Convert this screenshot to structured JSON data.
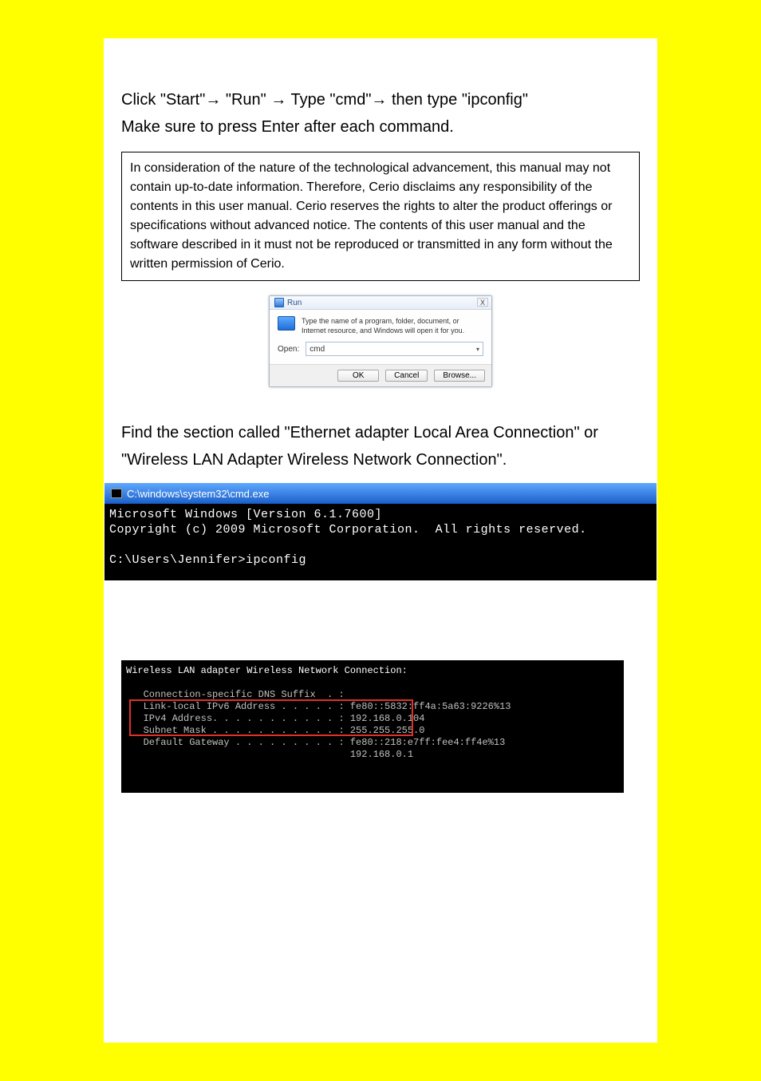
{
  "intro": {
    "p1": "Click \"Start\"→ \"Run\" → Type \"cmd\"→ then type \"ipconfig\"",
    "p2": "Make sure to press Enter after each command.",
    "legal": "In consideration of the nature of the technological advancement, this manual may not contain up-to-date information. Therefore, Cerio disclaims any responsibility of the contents in this user manual. Cerio reserves the rights to alter the product offerings or specifications without advanced notice. The contents of this user manual and the software described in it must not be reproduced or transmitted in any form without the written permission of Cerio."
  },
  "run_dialog": {
    "title": "Run",
    "close": "X",
    "description": "Type the name of a program, folder, document, or Internet resource, and Windows will open it for you.",
    "open_label": "Open:",
    "input_value": "cmd",
    "buttons": {
      "ok": "OK",
      "cancel": "Cancel",
      "browse": "Browse..."
    }
  },
  "instruction2": "Find the section called \"Ethernet adapter Local Area Connection\" or \"Wireless LAN Adapter Wireless Network Connection\".",
  "cmd_window": {
    "title_path": "C:\\windows\\system32\\cmd.exe",
    "line1": "Microsoft Windows [Version 6.1.7600]",
    "line2": "Copyright (c) 2009 Microsoft Corporation.  All rights reserved.",
    "blank": "",
    "prompt": "C:\\Users\\Jennifer>ipconfig"
  },
  "wlan": {
    "l0": "Wireless LAN adapter Wireless Network Connection:",
    "l1": "",
    "l2": "   Connection-specific DNS Suffix  . :",
    "l3": "   Link-local IPv6 Address . . . . . : fe80::5832:ff4a:5a63:9226%13",
    "l4": "   IPv4 Address. . . . . . . . . . . : 192.168.0.104",
    "l5": "   Subnet Mask . . . . . . . . . . . : 255.255.255.0",
    "l6": "   Default Gateway . . . . . . . . . : fe80::218:e7ff:fee4:ff4e%13",
    "l7": "                                       192.168.0.1"
  }
}
